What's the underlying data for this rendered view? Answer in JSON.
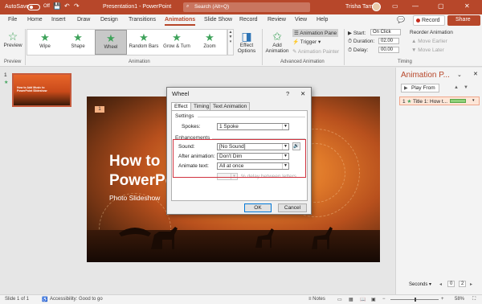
{
  "titlebar": {
    "autosave": "AutoSave",
    "autosave_state": "Off",
    "doc_title": "Presentation1 - PowerPoint",
    "search_placeholder": "Search (Alt+Q)",
    "user": "Trisha Tamo",
    "bg_color": "#b7472a"
  },
  "tabs": [
    "File",
    "Home",
    "Insert",
    "Draw",
    "Design",
    "Transitions",
    "Animations",
    "Slide Show",
    "Record",
    "Review",
    "View",
    "Help"
  ],
  "active_tab": "Animations",
  "record_label": "Record",
  "share_label": "Share",
  "ribbon": {
    "preview_label": "Preview",
    "preview_group": "Preview",
    "gallery": [
      {
        "label": "Wipe",
        "icon": "star-icon"
      },
      {
        "label": "Shape",
        "icon": "star-icon"
      },
      {
        "label": "Wheel",
        "icon": "star-icon",
        "selected": true
      },
      {
        "label": "Random Bars",
        "icon": "star-icon"
      },
      {
        "label": "Grow & Turn",
        "icon": "star-icon"
      },
      {
        "label": "Zoom",
        "icon": "star-icon"
      }
    ],
    "effect_options": "Effect",
    "effect_options2": "Options",
    "animation_group": "Animation",
    "add_animation": "Add",
    "add_animation2": "Animation",
    "animation_pane": "Animation Pane",
    "trigger": "Trigger",
    "animation_painter": "Animation Painter",
    "advanced_group": "Advanced Animation",
    "start_label": "Start:",
    "start_value": "On Click",
    "duration_label": "Duration:",
    "duration_value": "02.00",
    "delay_label": "Delay:",
    "delay_value": "00.00",
    "reorder": "Reorder Animation",
    "move_earlier": "Move Earlier",
    "move_later": "Move Later",
    "timing_group": "Timing"
  },
  "thumbnail": {
    "number": "1",
    "star": "★",
    "text": "How to Add Music to PowerPoint Slideshow"
  },
  "slide": {
    "anim_tag": "1",
    "title_line1": "How to",
    "title_line2": "PowerPo",
    "subtitle": "Photo Slideshow"
  },
  "animation_pane": {
    "title": "Animation P...",
    "play_from": "Play From",
    "item": "1",
    "item_label": "Title 1: How t...",
    "seconds_label": "Seconds",
    "page_cur": "0",
    "page_total": "2"
  },
  "dialog": {
    "title": "Wheel",
    "help": "?",
    "close": "✕",
    "tabs": [
      "Effect",
      "Timing",
      "Text Animation"
    ],
    "active_tab": "Effect",
    "settings_label": "Settings",
    "spokes_label": "Spokes:",
    "spokes_value": "1 Spoke",
    "enhancements_label": "Enhancements",
    "sound_label": "Sound:",
    "sound_value": "[No Sound]",
    "after_label": "After animation:",
    "after_value": "Don't Dim",
    "animate_text_label": "Animate text:",
    "animate_text_value": "All at once",
    "delay_between": "% delay between letters",
    "ok": "OK",
    "cancel": "Cancel",
    "highlight_color": "#d1333f"
  },
  "status": {
    "slide": "Slide 1 of 1",
    "accessibility": "Accessibility: Good to go",
    "notes": "Notes",
    "zoom": "58%"
  }
}
